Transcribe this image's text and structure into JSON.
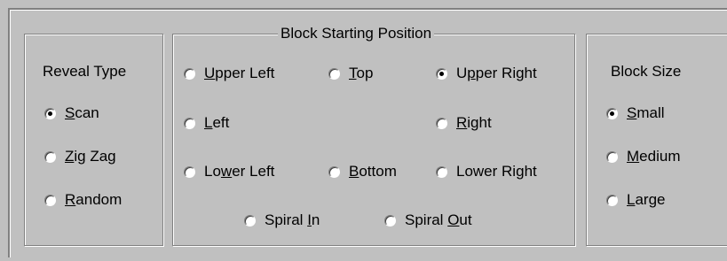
{
  "reveal_type": {
    "title": "Reveal Type",
    "options": [
      {
        "pre": "",
        "key": "S",
        "post": "can",
        "checked": true
      },
      {
        "pre": "",
        "key": "Z",
        "post": "ig Zag",
        "checked": false
      },
      {
        "pre": "",
        "key": "R",
        "post": "andom",
        "checked": false
      }
    ]
  },
  "block_position": {
    "title": "Block Starting Position",
    "options": [
      {
        "pre": "",
        "key": "U",
        "post": "pper Left",
        "checked": false
      },
      {
        "pre": "",
        "key": "T",
        "post": "op",
        "checked": false
      },
      {
        "pre": "U",
        "key": "p",
        "post": "per Right",
        "checked": true
      },
      {
        "pre": "",
        "key": "L",
        "post": "eft",
        "checked": false
      },
      {
        "pre": "",
        "key": "R",
        "post": "ight",
        "checked": false
      },
      {
        "pre": "Lo",
        "key": "w",
        "post": "er Left",
        "checked": false
      },
      {
        "pre": "",
        "key": "B",
        "post": "ottom",
        "checked": false
      },
      {
        "pre": "Lower Ri",
        "key": "g",
        "post": "ht",
        "checked": false
      },
      {
        "pre": "Spiral ",
        "key": "I",
        "post": "n",
        "checked": false
      },
      {
        "pre": "Spiral ",
        "key": "O",
        "post": "ut",
        "checked": false
      }
    ]
  },
  "block_size": {
    "title": "Block Size",
    "options": [
      {
        "pre": "",
        "key": "S",
        "post": "mall",
        "checked": true
      },
      {
        "pre": "",
        "key": "M",
        "post": "edium",
        "checked": false
      },
      {
        "pre": "",
        "key": "L",
        "post": "arge",
        "checked": false
      }
    ]
  }
}
